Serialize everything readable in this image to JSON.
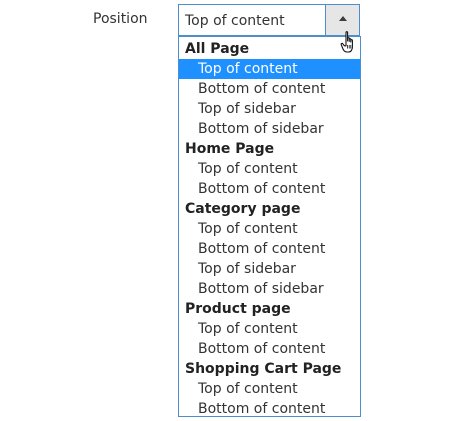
{
  "field": {
    "label": "Position"
  },
  "select": {
    "value": "Top of content",
    "toggle_icon": "arrow-up-icon"
  },
  "cursor": {
    "icon": "hand-pointer-icon"
  },
  "dropdown": {
    "selected_color": "#1e90ff",
    "border_color": "#4e8ec9",
    "groups": [
      {
        "label": "All Page",
        "options": [
          "Top of content",
          "Bottom of content",
          "Top of sidebar",
          "Bottom of sidebar"
        ]
      },
      {
        "label": "Home Page",
        "options": [
          "Top of content",
          "Bottom of content"
        ]
      },
      {
        "label": "Category page",
        "options": [
          "Top of content",
          "Bottom of content",
          "Top of sidebar",
          "Bottom of sidebar"
        ]
      },
      {
        "label": "Product page",
        "options": [
          "Top of content",
          "Bottom of content"
        ]
      },
      {
        "label": "Shopping Cart Page",
        "options": [
          "Top of content",
          "Bottom of content"
        ]
      }
    ]
  }
}
